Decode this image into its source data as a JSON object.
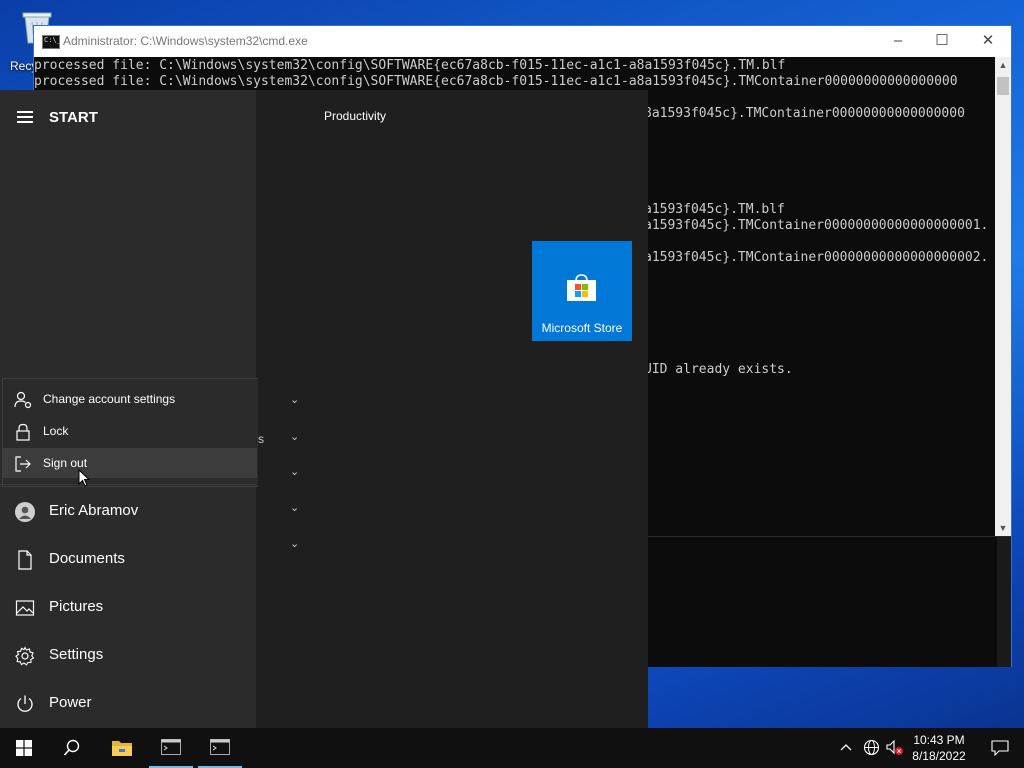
{
  "desktop": {
    "recycle_bin_label": "Recycle Bin"
  },
  "cmd": {
    "title": "Administrator: C:\\Windows\\system32\\cmd.exe",
    "lines_top": [
      "processed file: C:\\Windows\\system32\\config\\SOFTWARE{ec67a8cb-f015-11ec-a1c1-a8a1593f045c}.TM.blf",
      "processed file: C:\\Windows\\system32\\config\\SOFTWARE{ec67a8cb-f015-11ec-a1c1-a8a1593f045c}.TMContainer00000000000000000"
    ],
    "lines_visible": [
      "8a1593f045c}.TMContainer00000000000000000",
      "a1593f045c}.TM.blf",
      "a1593f045c}.TMContainer00000000000000000001.",
      "a1593f045c}.TMContainer00000000000000000002.",
      "UID already exists."
    ]
  },
  "start_menu": {
    "header_label": "START",
    "group_label": "Productivity",
    "tile_label": "Microsoft Store",
    "partial_text": "s",
    "account_popup": {
      "items": [
        {
          "label": "Change account settings",
          "icon": "person-settings-icon"
        },
        {
          "label": "Lock",
          "icon": "lock-icon"
        },
        {
          "label": "Sign out",
          "icon": "sign-out-icon"
        }
      ]
    },
    "side_items": [
      {
        "label": "Eric Abramov",
        "icon": "user-avatar-icon"
      },
      {
        "label": "Documents",
        "icon": "document-icon"
      },
      {
        "label": "Pictures",
        "icon": "picture-icon"
      },
      {
        "label": "Settings",
        "icon": "gear-icon"
      },
      {
        "label": "Power",
        "icon": "power-icon"
      }
    ]
  },
  "taskbar": {
    "time": "10:43 PM",
    "date": "8/18/2022"
  }
}
